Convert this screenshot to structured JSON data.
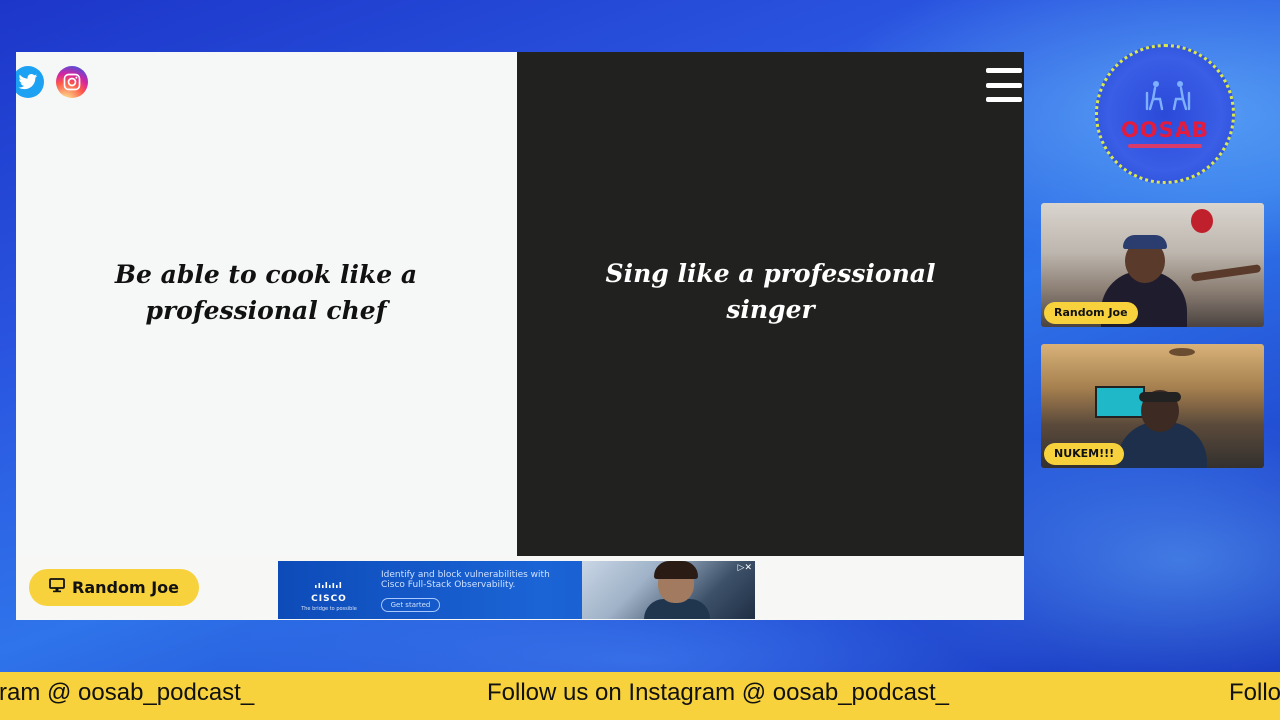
{
  "stage": {
    "left_prompt": "Be able to cook like a professional chef",
    "right_prompt": "Sing like a professional singer"
  },
  "social": {
    "icons": [
      "twitter-icon",
      "instagram-icon"
    ]
  },
  "presenter": {
    "name": "Random Joe"
  },
  "ad": {
    "brand": "CISCO",
    "tagline": "The bridge to possible",
    "copy": "Identify and block vulnerabilities with Cisco Full-Stack Observability.",
    "cta": "Get started",
    "choices": "▷✕"
  },
  "logo": {
    "text": "OOSAB"
  },
  "cameras": [
    {
      "label": "Random Joe"
    },
    {
      "label": "NUKEM!!!"
    }
  ],
  "ticker": {
    "left_fragment": "ram @ oosab_podcast_",
    "main": "Follow us on Instagram @ oosab_podcast_",
    "right_fragment": "Follo"
  },
  "colors": {
    "accent_yellow": "#f7d23c",
    "stage_dark": "#21211f",
    "background_blue": "#2a55e0"
  }
}
